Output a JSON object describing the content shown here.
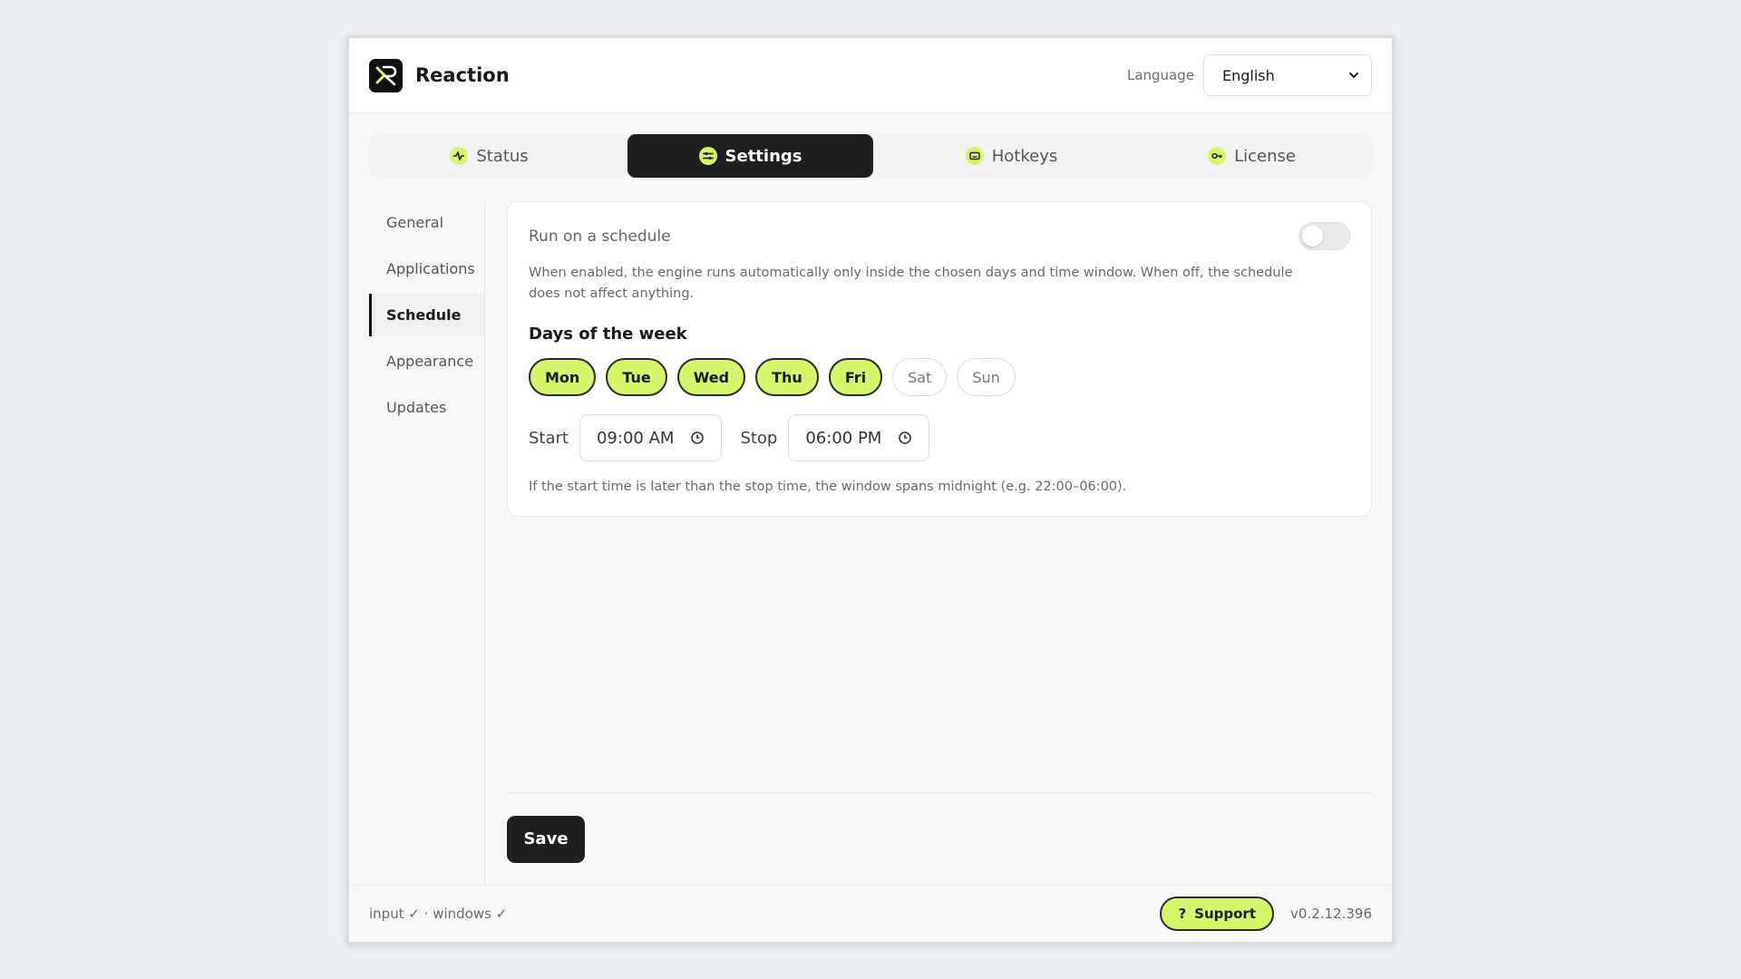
{
  "app": {
    "title": "Reaction"
  },
  "header": {
    "language_label": "Language",
    "language_value": "English"
  },
  "tabs": [
    {
      "label": "Status",
      "icon": "pulse-icon"
    },
    {
      "label": "Settings",
      "icon": "sliders-icon"
    },
    {
      "label": "Hotkeys",
      "icon": "keyboard-icon"
    },
    {
      "label": "License",
      "icon": "key-icon"
    }
  ],
  "sidebar": {
    "items": [
      {
        "label": "General"
      },
      {
        "label": "Applications"
      },
      {
        "label": "Schedule"
      },
      {
        "label": "Appearance"
      },
      {
        "label": "Updates"
      }
    ]
  },
  "schedule": {
    "toggle_label": "Run on a schedule",
    "toggle_on": false,
    "description": "When enabled, the engine runs automatically only inside the chosen days and time window. When off, the schedule does not affect anything.",
    "days_title": "Days of the week",
    "days": [
      {
        "label": "Mon",
        "selected": true
      },
      {
        "label": "Tue",
        "selected": true
      },
      {
        "label": "Wed",
        "selected": true
      },
      {
        "label": "Thu",
        "selected": true
      },
      {
        "label": "Fri",
        "selected": true
      },
      {
        "label": "Sat",
        "selected": false
      },
      {
        "label": "Sun",
        "selected": false
      }
    ],
    "start_label": "Start",
    "start_value": "09:00 AM",
    "stop_label": "Stop",
    "stop_value": "06:00 PM",
    "hint": "If the start time is later than the stop time, the window spans midnight (e.g. 22:00–06:00)."
  },
  "actions": {
    "save_label": "Save"
  },
  "footer": {
    "status": "input ✓ · windows ✓",
    "support_icon": "?",
    "support_label": "Support",
    "version": "v0.2.12.396"
  },
  "colors": {
    "accent": "#d5f56a",
    "dark": "#1d1f21"
  }
}
